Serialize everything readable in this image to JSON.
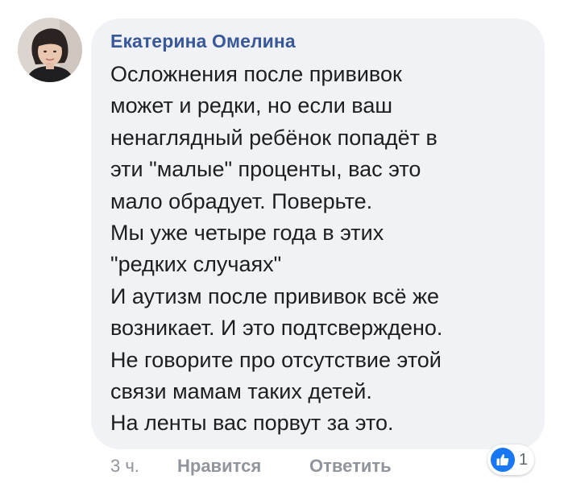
{
  "comment": {
    "author": "Екатерина Омелина",
    "lines": [
      "Осложнения после прививок",
      "может и редки, но если ваш",
      "ненаглядный ребёнок попадёт в",
      "эти \"малые\" проценты, вас это",
      "мало обрадует. Поверьте.",
      "Мы уже четыре года в этих",
      "\"редких случаях\"",
      "И аутизм после прививок всё же",
      "возникает. И это подтсверждено.",
      "Не говорите про отсутствие этой",
      "связи мамам таких детей.",
      "На ленты вас порвут за это."
    ]
  },
  "actions": {
    "time": "3 ч.",
    "like_label": "Нравится",
    "reply_label": "Ответить"
  },
  "reactions": {
    "icon": "thumbs-up-icon",
    "count": "1",
    "color": "#1877f2"
  },
  "colors": {
    "author": "#385898",
    "bubble": "#f0f2f5",
    "text": "#1c1e21",
    "meta": "#90949c"
  }
}
